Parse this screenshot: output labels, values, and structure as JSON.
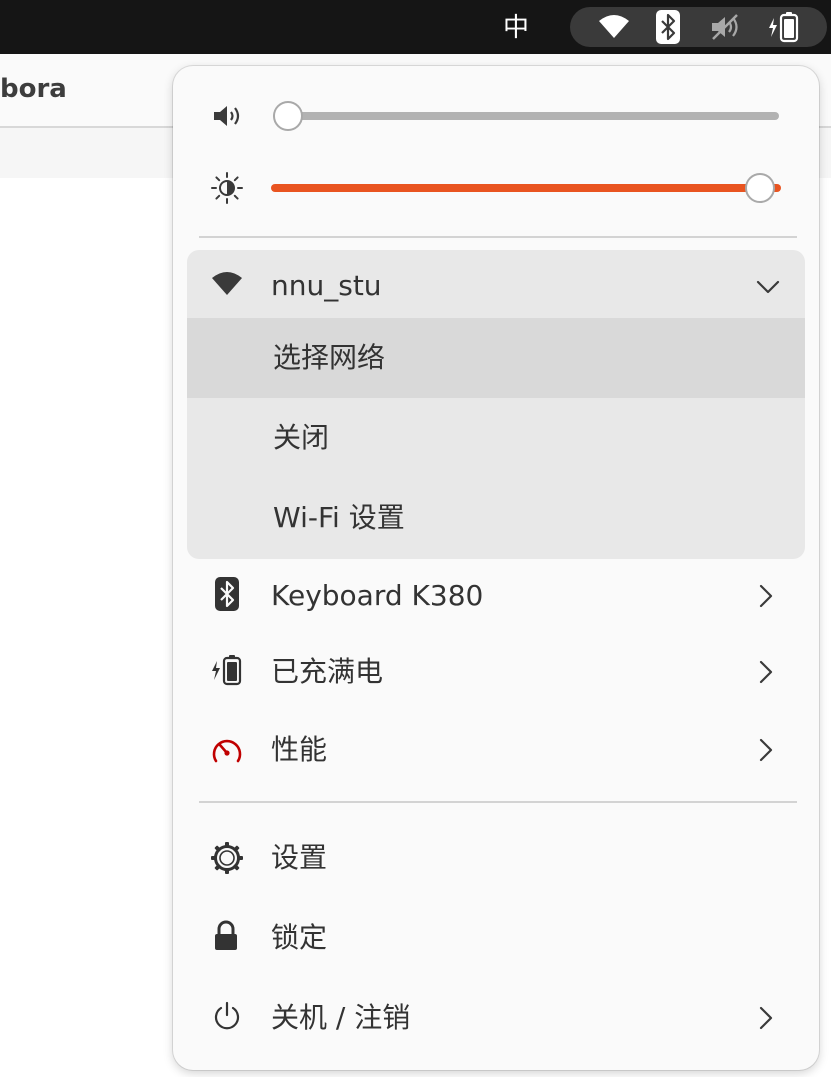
{
  "topbar": {
    "ime_label": "中",
    "icons": [
      "wifi-icon",
      "bluetooth-icon",
      "speaker-muted-icon",
      "battery-charging-icon"
    ]
  },
  "background_window": {
    "title": "bora"
  },
  "quick_settings": {
    "volume": {
      "icon": "speaker-icon",
      "level": 0
    },
    "brightness": {
      "icon": "brightness-icon",
      "level": 1.0,
      "accent": "#e95420"
    },
    "wifi": {
      "network": "nnu_stu",
      "expanded": true,
      "items": [
        {
          "label": "选择网络",
          "highlighted": true
        },
        {
          "label": "关闭"
        },
        {
          "label": "Wi-Fi 设置"
        }
      ]
    },
    "rows": [
      {
        "icon": "bluetooth-icon",
        "label": "Keyboard K380",
        "submenu": true
      },
      {
        "icon": "battery-charging-icon",
        "label": "已充满电",
        "submenu": true
      },
      {
        "icon": "performance-icon",
        "label": "性能",
        "submenu": true,
        "icon_color": "#c00000"
      }
    ],
    "actions": [
      {
        "icon": "settings-icon",
        "label": "设置",
        "submenu": false
      },
      {
        "icon": "lock-icon",
        "label": "锁定",
        "submenu": false
      },
      {
        "icon": "power-icon",
        "label": "关机 / 注销",
        "submenu": true
      }
    ]
  }
}
